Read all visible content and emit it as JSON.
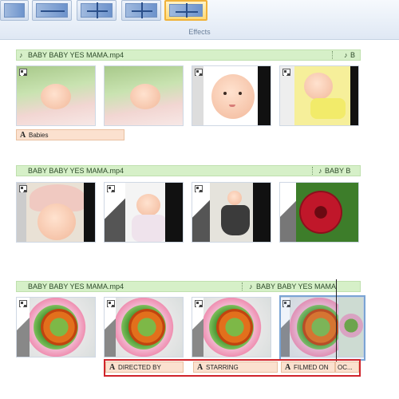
{
  "ribbon": {
    "section_label": "Effects"
  },
  "rows": [
    {
      "clip_title": "BABY BABY YES MAMA.mp4",
      "clip_title_short": "B",
      "caption": "Babies"
    },
    {
      "clip_title": "BABY BABY YES MAMA.mp4",
      "clip_title_short": "BABY B"
    },
    {
      "clip_title": "BABY BABY YES MAMA.mp4",
      "clip_title_secondary": "BABY BABY YES MAMA",
      "captions": [
        "DIRECTED BY",
        "STARRING",
        "FILMED ON",
        "OC..."
      ]
    }
  ],
  "icons": {
    "music_note": "music-note-icon",
    "text_caption": "A"
  },
  "colors": {
    "clip_band": "#d6f0c8",
    "caption_band": "#fbe1cf",
    "highlight_box": "#d0242b",
    "selected_effect": "#f0b23a"
  }
}
